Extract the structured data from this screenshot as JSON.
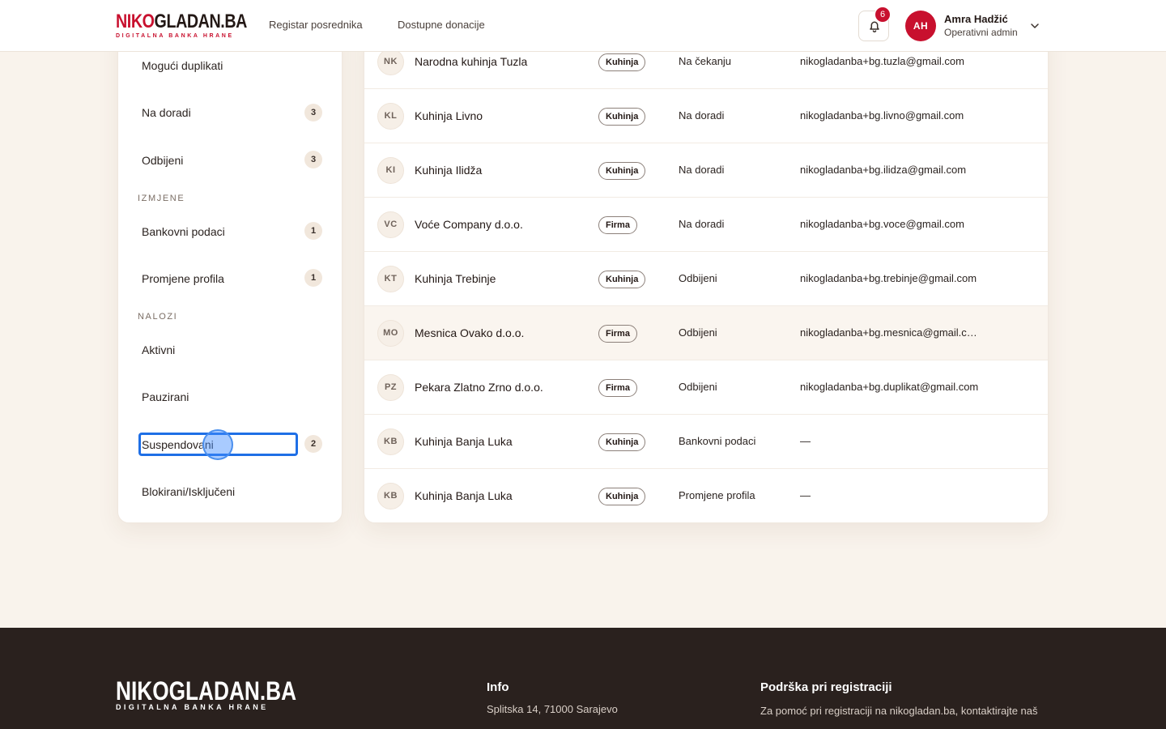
{
  "brand": {
    "name_red": "NIKO",
    "name_dark": "GLADAN.BA",
    "tagline": "DIGITALNA BANKA HRANE"
  },
  "nav": {
    "link1": "Registar posrednika",
    "link2": "Dostupne donacije"
  },
  "notifications": {
    "count": "6"
  },
  "user": {
    "initials": "AH",
    "name": "Amra Hadžić",
    "role": "Operativni admin"
  },
  "sidebar": {
    "items": [
      {
        "label": "Mogući duplikati",
        "count": ""
      },
      {
        "label": "Na doradi",
        "count": "3"
      },
      {
        "label": "Odbijeni",
        "count": "3"
      },
      {
        "label": "Bankovni podaci",
        "count": "1"
      },
      {
        "label": "Promjene profila",
        "count": "1"
      },
      {
        "label": "Aktivni",
        "count": ""
      },
      {
        "label": "Pauzirani",
        "count": ""
      },
      {
        "label": "Suspendovani",
        "count": "2"
      },
      {
        "label": "Blokirani/Isključeni",
        "count": ""
      }
    ],
    "sections": {
      "izmjene": "IZMJENE",
      "nalozi": "NALOZI"
    }
  },
  "table": {
    "rows": [
      {
        "initials": "NK",
        "name": "Narodna kuhinja Tuzla",
        "type": "Kuhinja",
        "status": "Na čekanju",
        "email": "nikogladanba+bg.tuzla@gmail.com"
      },
      {
        "initials": "KL",
        "name": "Kuhinja Livno",
        "type": "Kuhinja",
        "status": "Na doradi",
        "email": "nikogladanba+bg.livno@gmail.com"
      },
      {
        "initials": "KI",
        "name": "Kuhinja Ilidža",
        "type": "Kuhinja",
        "status": "Na doradi",
        "email": "nikogladanba+bg.ilidza@gmail.com"
      },
      {
        "initials": "VC",
        "name": "Voće Company d.o.o.",
        "type": "Firma",
        "status": "Na doradi",
        "email": "nikogladanba+bg.voce@gmail.com"
      },
      {
        "initials": "KT",
        "name": "Kuhinja Trebinje",
        "type": "Kuhinja",
        "status": "Odbijeni",
        "email": "nikogladanba+bg.trebinje@gmail.com"
      },
      {
        "initials": "MO",
        "name": "Mesnica Ovako d.o.o.",
        "type": "Firma",
        "status": "Odbijeni",
        "email": "nikogladanba+bg.mesnica@gmail.com"
      },
      {
        "initials": "PZ",
        "name": "Pekara Zlatno Zrno d.o.o.",
        "type": "Firma",
        "status": "Odbijeni",
        "email": "nikogladanba+bg.duplikat@gmail.com"
      },
      {
        "initials": "KB",
        "name": "Kuhinja Banja Luka",
        "type": "Kuhinja",
        "status": "Bankovni podaci",
        "email": "—"
      },
      {
        "initials": "KB",
        "name": "Kuhinja Banja Luka",
        "type": "Kuhinja",
        "status": "Promjene profila",
        "email": "—"
      }
    ]
  },
  "footer": {
    "logo": "NIKOGLADAN.BA",
    "logo_sub": "DIGITALNA BANKA HRANE",
    "info_heading": "Info",
    "address": "Splitska 14, 71000 Sarajevo",
    "support_heading": "Podrška pri registraciji",
    "support_text": "Za pomoć pri registraciji na nikogladan.ba, kontaktirajte naš"
  },
  "colors": {
    "brand_red": "#c8102e",
    "page_bg": "#f9f3ec",
    "footer_bg": "#2a211e",
    "focus_blue": "#1f6fe6"
  }
}
